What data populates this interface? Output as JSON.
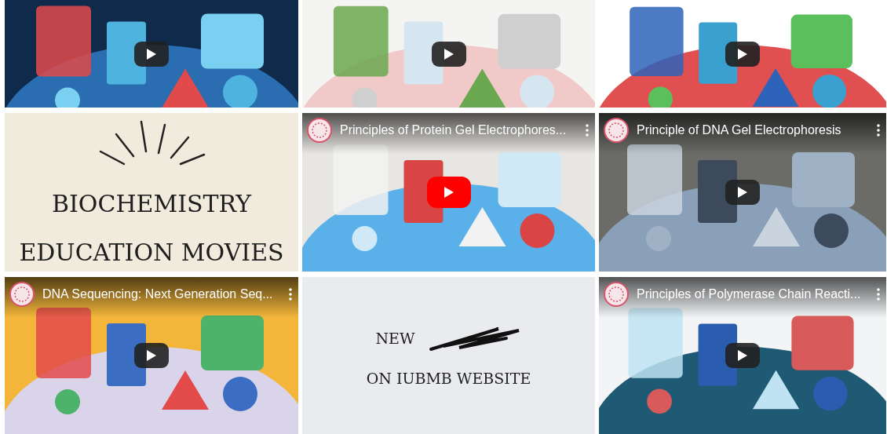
{
  "tiles": [
    {
      "kind": "video",
      "play_highlighted": false
    },
    {
      "kind": "video",
      "play_highlighted": false
    },
    {
      "kind": "video",
      "play_highlighted": false
    },
    {
      "kind": "graphic",
      "lines": [
        "BIOCHEMISTRY",
        "EDUCATION MOVIES"
      ]
    },
    {
      "kind": "video",
      "title": "Principles of Protein Gel Electrophores...",
      "play_highlighted": true
    },
    {
      "kind": "video",
      "title": "Principle of DNA Gel Electrophoresis",
      "play_highlighted": false
    },
    {
      "kind": "video",
      "title": "DNA Sequencing: Next Generation Seq...",
      "play_highlighted": false
    },
    {
      "kind": "graphic",
      "lines": [
        "NEW",
        "ON IUBMB WEBSITE"
      ]
    },
    {
      "kind": "video",
      "title": "Principles of Polymerase Chain Reacti...",
      "play_highlighted": false
    }
  ]
}
